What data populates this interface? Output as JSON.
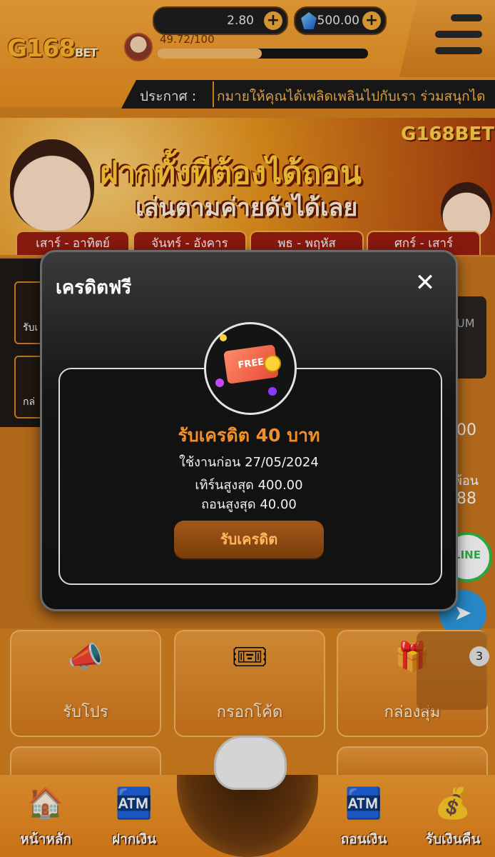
{
  "header": {
    "logo": "G168",
    "logo_suffix": "BET",
    "credit_balance": "2.80",
    "gem_balance": "500.00",
    "level_progress_text": "49.72/100",
    "level_progress_fraction": 0.4972,
    "announcement_label": "ประกาศ :",
    "announcement_text": "กมายให้คุณได้เพลิดเพลินไปกับเรา ร่วมสนุกได"
  },
  "banner": {
    "logo": "G168",
    "logo_suffix": "BET",
    "line1": "ฝากทั้งทีต้องได้ถอน",
    "line2": "เล่นตามค่ายดังได้เลย",
    "days": [
      "เสาร์ - อาทิตย์",
      "จันทร์ - อังคาร",
      "พธ - พฤหัส",
      "ศกร์ - เสาร์"
    ]
  },
  "background": {
    "left_tiles": [
      "รับเ",
      "กล่"
    ],
    "right_snippets": [
      "UM",
      "00",
      "พ้อน",
      "88"
    ],
    "line_label": "LINE",
    "badge_count": "3"
  },
  "cards": [
    {
      "label": "รับโปร",
      "icon": "megaphone-icon"
    },
    {
      "label": "กรอกโค้ด",
      "icon": "code-ticket-icon"
    },
    {
      "label": "กล่องสุ่ม",
      "icon": "mystery-box-icon"
    }
  ],
  "bottom_nav": [
    {
      "label": "หน้าหลัก",
      "icon": "home-icon"
    },
    {
      "label": "ฝากเงิน",
      "icon": "deposit-icon"
    },
    {
      "label": "ถอนเงิน",
      "icon": "withdraw-icon"
    },
    {
      "label": "รับเงินคืน",
      "icon": "cashback-icon"
    }
  ],
  "modal": {
    "title": "เครดิตฟรี",
    "card_text": "FREE",
    "reward_title": "รับเครดิต 40 บาท",
    "expire": "ใช้งานก่อน 27/05/2024",
    "turnover": "เทิร์นสูงสุด 400.00",
    "max_withdraw": "ถอนสูงสุด 40.00",
    "claim_button": "รับเครดิต"
  },
  "colors": {
    "accent": "#f0902c",
    "header_bg": "#e98d1f",
    "modal_bg": "#151515"
  }
}
